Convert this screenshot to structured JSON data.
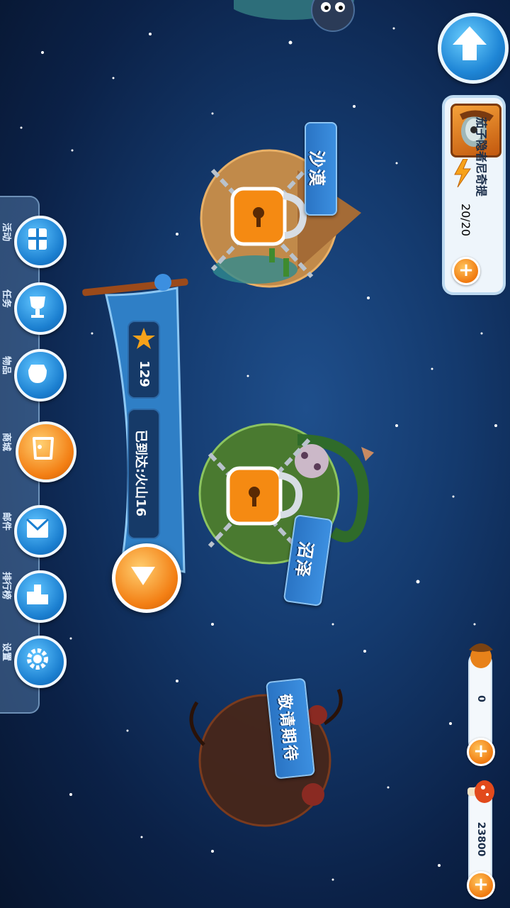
{
  "profile": {
    "name": "茄子隐者尼奇提",
    "energy": "20/20",
    "add_energy_label": "+"
  },
  "currencies": [
    {
      "icon": "acorn-icon",
      "value": "0",
      "add_label": "+"
    },
    {
      "icon": "mushroom-icon",
      "value": "23800",
      "add_label": "+"
    }
  ],
  "menu": {
    "items": [
      {
        "label": "活动",
        "icon": "gift-icon"
      },
      {
        "label": "任务",
        "icon": "trophy-icon"
      },
      {
        "label": "物品",
        "icon": "bag-icon"
      },
      {
        "label": "商城",
        "icon": "cart-icon"
      },
      {
        "label": "邮件",
        "icon": "mail-icon"
      },
      {
        "label": "排行榜",
        "icon": "podium-icon"
      },
      {
        "label": "设置",
        "icon": "gear-icon"
      }
    ]
  },
  "progress": {
    "stars": "129",
    "reached": "已到达:火山16"
  },
  "planets": [
    {
      "name": "沙漠",
      "locked": true
    },
    {
      "name": "沼泽",
      "locked": true
    },
    {
      "name": "敬请期待",
      "locked": false
    }
  ],
  "colors": {
    "accent_orange": "#f37f14",
    "accent_blue": "#1f86d6",
    "background": "#143a6e"
  }
}
